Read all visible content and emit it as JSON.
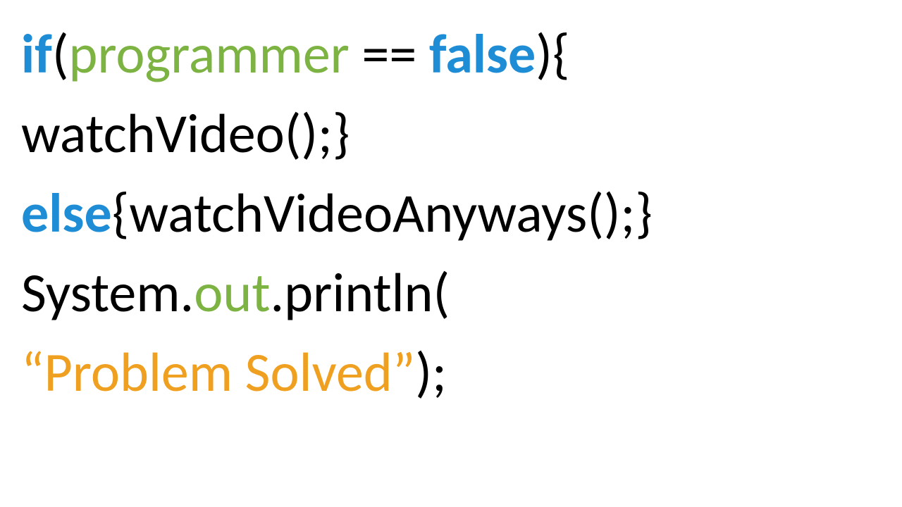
{
  "code": {
    "line1": {
      "if": "if",
      "lparen": "(",
      "programmer": "programmer",
      "space1": " ",
      "eqeq": "==",
      "space2": " ",
      "false": "false",
      "rparen": ")",
      "lbrace": "{"
    },
    "line2": {
      "watchVideo": "watchVideo();",
      "rbrace": "}"
    },
    "line3": {
      "else": "else",
      "rest": "{watchVideoAnyways();}"
    },
    "line4": {
      "system": "System.",
      "out": "out",
      "println": ".println("
    },
    "line5": {
      "string": "“Problem Solved”",
      "close": ");"
    }
  },
  "colors": {
    "blue": "#1f8dd6",
    "green": "#7cb342",
    "gold": "#f0a020",
    "black": "#000000"
  }
}
